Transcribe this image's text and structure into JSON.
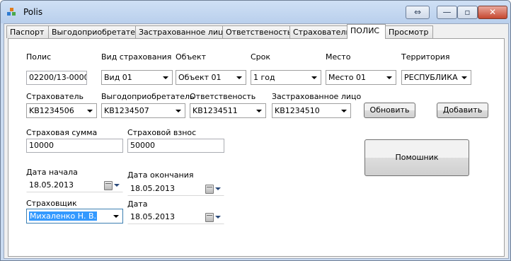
{
  "window": {
    "title": "Polis"
  },
  "tabs": [
    "Паспорт",
    "Выгодоприобретатель",
    "Застрахованное лицо",
    "Ответственость",
    "Страхователь",
    "ПОЛИС",
    "Просмотр"
  ],
  "active_tab": "ПОЛИС",
  "form": {
    "polis": {
      "label": "Полис",
      "value": "02200/13-00001"
    },
    "insurance_type": {
      "label": "Вид страхования",
      "value": "Вид 01"
    },
    "object": {
      "label": "Объект",
      "value": "Объект 01"
    },
    "term": {
      "label": "Срок",
      "value": "1 год"
    },
    "place": {
      "label": "Место",
      "value": "Место 01"
    },
    "territory": {
      "label": "Территория",
      "value": "РЕСПУБЛИКА"
    },
    "policyholder": {
      "label": "Страхователь",
      "value": "KB1234506"
    },
    "beneficiary": {
      "label": "Выгодоприобретатель",
      "value": "KB1234507"
    },
    "liability": {
      "label": "Ответственость",
      "value": "KB1234511"
    },
    "insured_person": {
      "label": "Застрахованное лицо",
      "value": "KB1234510"
    },
    "sum_insured": {
      "label": "Страховая сумма",
      "value": "10000"
    },
    "premium": {
      "label": "Страховой взнос",
      "value": "50000"
    },
    "start_date": {
      "label": "Дата начала",
      "value": "18.05.2013"
    },
    "end_date": {
      "label": "Дата окончания",
      "value": "18.05.2013"
    },
    "insurer": {
      "label": "Страховщик",
      "value": "Михаленко Н. В."
    },
    "date": {
      "label": "Дата",
      "value": "18.05.2013"
    }
  },
  "buttons": {
    "refresh": "Обновить",
    "add": "Добавить",
    "assistant": "Помошник"
  },
  "icons": {
    "app": "windows-form-icon",
    "calendar": "calendar-dropdown-icon"
  }
}
